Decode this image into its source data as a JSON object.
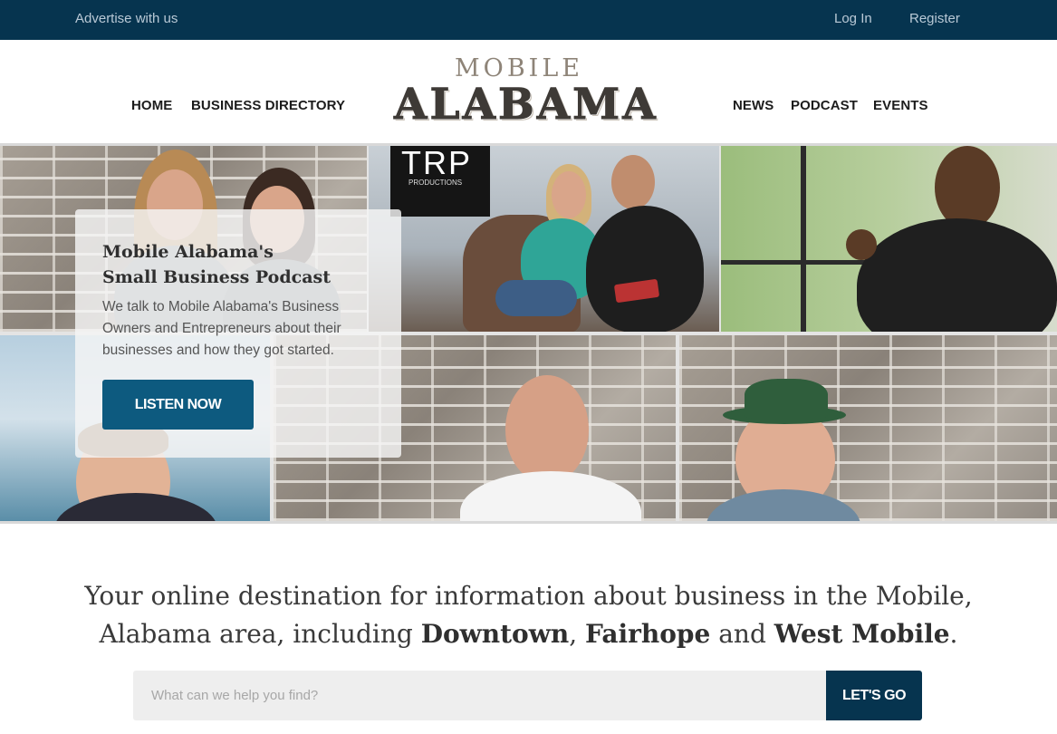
{
  "topbar": {
    "advertise": "Advertise with us",
    "login": "Log In",
    "register": "Register"
  },
  "nav": {
    "left": [
      "HOME",
      "BUSINESS DIRECTORY"
    ],
    "right": [
      "NEWS",
      "PODCAST",
      "EVENTS"
    ]
  },
  "logo": {
    "top": "MOBILE",
    "main": "ALABAMA"
  },
  "hero": {
    "sign_text": "TRP",
    "sign_sub": "PRODUCTIONS",
    "card": {
      "title_line1": "Mobile Alabama's",
      "title_line2": "Small Business Podcast",
      "description": "We talk to Mobile Alabama's Business Owners and Entrepreneurs about their businesses and how they got started.",
      "button": "LISTEN NOW"
    }
  },
  "tagline": {
    "part1": "Your online destination for information about business in the Mobile, Alabama area, including ",
    "bold1": "Downtown",
    "sep1": ", ",
    "bold2": "Fairhope",
    "sep2": " and ",
    "bold3": "West Mobile",
    "end": "."
  },
  "search": {
    "placeholder": "What can we help you find?",
    "button": "LET'S GO"
  },
  "colors": {
    "topbar": "#06344f",
    "button_primary": "#0d5a7f",
    "search_button": "#06344f"
  }
}
